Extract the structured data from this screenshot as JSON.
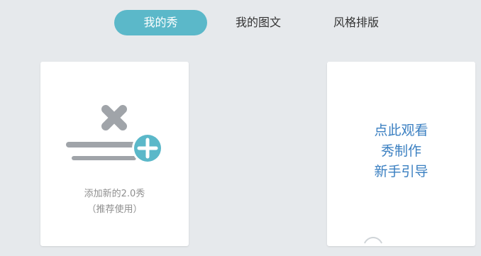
{
  "tabs": [
    {
      "label": "我的秀",
      "active": true
    },
    {
      "label": "我的图文",
      "active": false
    },
    {
      "label": "风格排版",
      "active": false
    }
  ],
  "add_card": {
    "icon": "add-show-icon",
    "label_line1": "添加新的2.0秀",
    "label_line2": "（推荐使用）"
  },
  "guide_card": {
    "line1": "点此观看",
    "line2": "秀制作",
    "line3": "新手引导"
  },
  "colors": {
    "accent": "#5bb8c9",
    "link_blue": "#3a7fc1",
    "icon_gray": "#a0a4a9",
    "background": "#e6e9ec"
  }
}
